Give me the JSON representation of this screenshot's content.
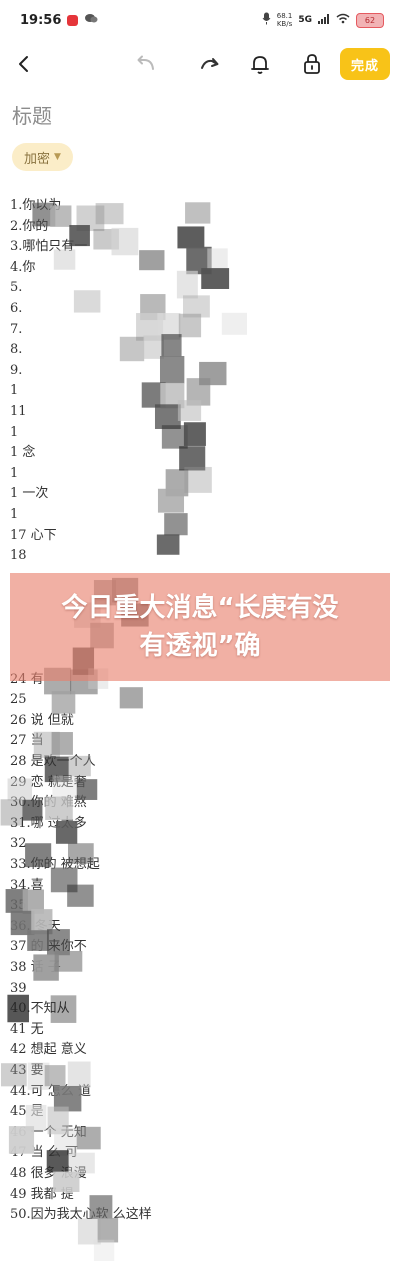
{
  "status_bar": {
    "time": "19:56",
    "net_speed_value": "68.1",
    "net_speed_unit": "KB/s",
    "signal": "5G",
    "battery": "62"
  },
  "toolbar": {
    "done_label": "完成"
  },
  "note": {
    "title": "标题",
    "tag_label": "加密",
    "lines": [
      "1.你以为",
      "2.你的",
      "3.哪怕只有一",
      "4.你",
      "5.",
      "6.",
      "7.",
      "8.",
      "9.",
      "1",
      "11",
      "1",
      "1 念",
      "1",
      "1 一次",
      "1",
      "17 心下",
      "18",
      "",
      "",
      "",
      "",
      "",
      "24 有",
      "25",
      "26 说 但就",
      "27 当",
      "28 是欢一个人",
      "29 恋 就是奢",
      "30.你的 难熬",
      "31.哪 过太多",
      "32",
      "33.你的 被想起",
      "34.喜",
      "35",
      "36. 冬天",
      "37 的 来你不",
      "38 话 子",
      "39",
      "40.不知从",
      "41 无",
      "42 想起 意义",
      "43 要",
      "44.可 怎么 道",
      "45 是",
      "46 一个 无知",
      "47 当 么 可",
      "48 很多 浪漫",
      "49 我都 提",
      "50.因为我太心软 么这样"
    ]
  },
  "banner": {
    "text": "今日重大消息“长庚有没有透视”确"
  },
  "icons": {
    "back": "chevron-left-icon",
    "undo": "undo-arrow-icon",
    "redo": "redo-arrow-icon",
    "reminder": "bell-icon",
    "lock": "lock-icon",
    "notification": "app-notification-icon",
    "chat": "chat-bubble-icon",
    "mic": "microphone-icon",
    "wifi": "wifi-icon"
  },
  "colors": {
    "accent": "#f8c318",
    "tag_background": "#fbedc8",
    "banner_background": "#e8806c",
    "battery_fill": "#f2b3b5"
  }
}
